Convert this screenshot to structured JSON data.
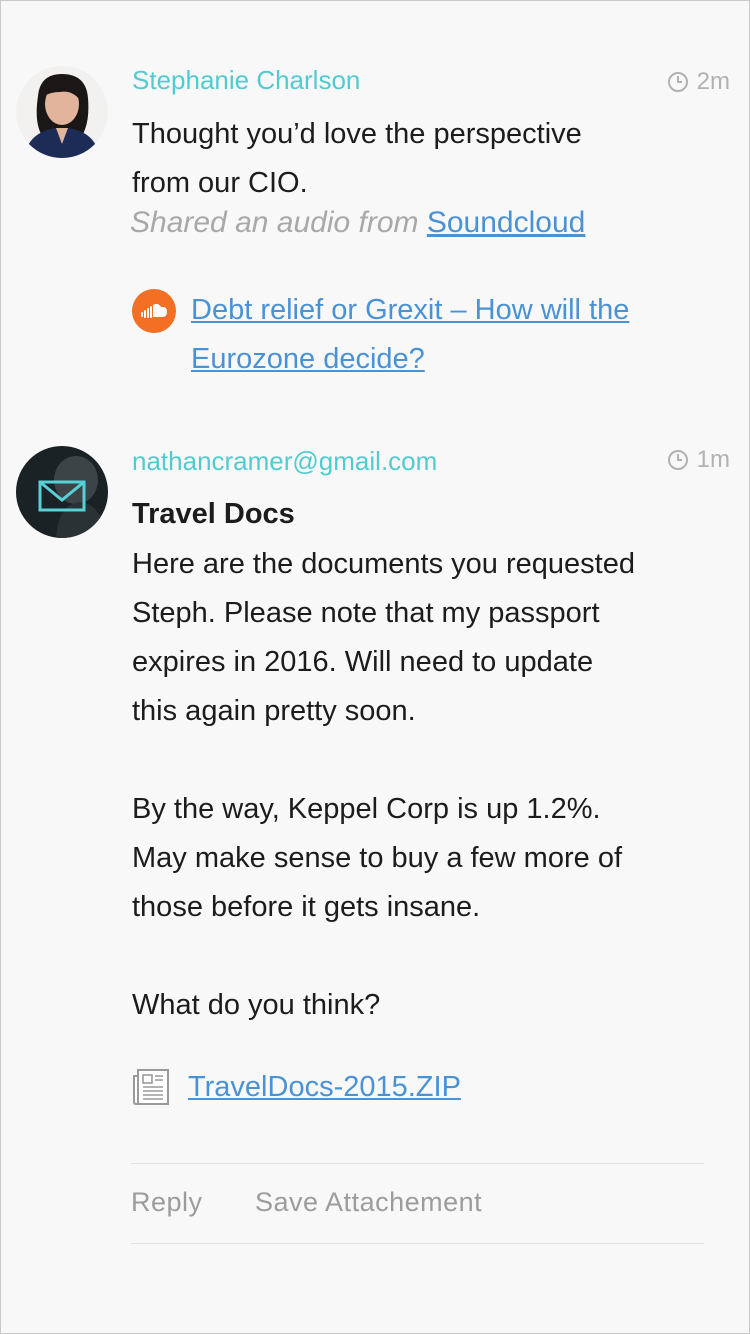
{
  "messages": [
    {
      "sender": "Stephanie Charlson",
      "time": "2m",
      "body_line1": "Thought you’d love the perspective",
      "body_line2": "from our CIO.",
      "shared_prefix": "Shared an audio from",
      "shared_source": "Soundcloud",
      "audio_title_line1": "Debt relief or Grexit – How will the",
      "audio_title_line2": "Eurozone decide?"
    },
    {
      "sender": "nathancramer@gmail.com",
      "time": "1m",
      "subject": "Travel Docs",
      "para1": [
        "Here are the documents you requested",
        "Steph. Please note that my passport",
        "expires in 2016. Will need to update",
        "this again pretty soon."
      ],
      "para2": [
        "By the way, Keppel Corp is up 1.2%.",
        "May make sense to buy a few more of",
        "those before it gets insane."
      ],
      "para3": "What do you think?",
      "attachment": "TravelDocs-2015.ZIP",
      "actions": {
        "reply": "Reply",
        "save": "Save Attachement"
      }
    }
  ],
  "colors": {
    "accent": "#52cbd0",
    "link": "#4a92d6",
    "soundcloud": "#f26f23",
    "muted": "#9c9c9c"
  },
  "icons": [
    "clock-icon",
    "soundcloud-icon",
    "document-icon",
    "mail-icon"
  ]
}
